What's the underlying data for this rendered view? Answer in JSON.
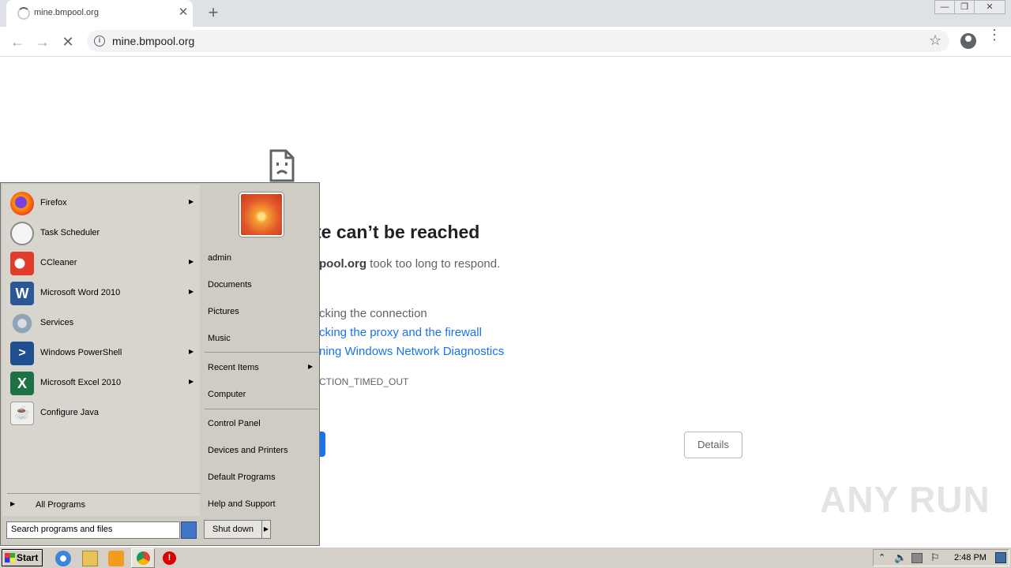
{
  "browser": {
    "tab_title": "mine.bmpool.org",
    "url": "mine.bmpool.org"
  },
  "error_page": {
    "title": "te can’t be reached",
    "desc_host": "pool.org",
    "desc_rest": " took too long to respond.",
    "try_items": [
      {
        "text": "cking the connection",
        "link": false
      },
      {
        "text": "cking the proxy and the firewall",
        "link": true
      },
      {
        "text": "ning Windows Network Diagnostics",
        "link": true
      }
    ],
    "error_code": "CTION_TIMED_OUT",
    "details_label": "Details",
    "colors": {
      "link": "#1a73e8",
      "button": "#1a73e8"
    }
  },
  "start_menu": {
    "programs": [
      {
        "label": "Firefox",
        "icon": "firefox-icon",
        "submenu": true
      },
      {
        "label": "Task Scheduler",
        "icon": "clock-icon",
        "submenu": false
      },
      {
        "label": "CCleaner",
        "icon": "ccleaner-icon",
        "submenu": true
      },
      {
        "label": "Microsoft Word 2010",
        "icon": "word-icon",
        "submenu": true
      },
      {
        "label": "Services",
        "icon": "gear-icon",
        "submenu": false
      },
      {
        "label": "Windows PowerShell",
        "icon": "powershell-icon",
        "submenu": true
      },
      {
        "label": "Microsoft Excel 2010",
        "icon": "excel-icon",
        "submenu": true
      },
      {
        "label": "Configure Java",
        "icon": "java-icon",
        "submenu": false
      }
    ],
    "all_programs": "All Programs",
    "search_placeholder": "Search programs and files",
    "right_items": {
      "user": "admin",
      "documents": "Documents",
      "pictures": "Pictures",
      "music": "Music",
      "recent": "Recent Items",
      "computer": "Computer",
      "control_panel": "Control Panel",
      "devices": "Devices and Printers",
      "default_programs": "Default Programs",
      "help": "Help and Support"
    },
    "shutdown": "Shut down"
  },
  "taskbar": {
    "start": "Start",
    "clock": "2:48 PM"
  },
  "watermark": "ANY RUN"
}
